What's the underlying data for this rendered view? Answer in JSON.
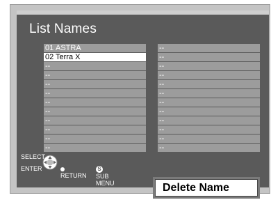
{
  "header": {
    "title": "List Names"
  },
  "list_left": [
    {
      "num": "01",
      "name": "ASTRA",
      "selected": false
    },
    {
      "num": "02",
      "name": "Terra X",
      "selected": true
    },
    {
      "num": "--",
      "name": ""
    },
    {
      "num": "--",
      "name": ""
    },
    {
      "num": "--",
      "name": ""
    },
    {
      "num": "--",
      "name": ""
    },
    {
      "num": "--",
      "name": ""
    },
    {
      "num": "--",
      "name": ""
    },
    {
      "num": "--",
      "name": ""
    },
    {
      "num": "--",
      "name": ""
    },
    {
      "num": "--",
      "name": ""
    },
    {
      "num": "--",
      "name": ""
    }
  ],
  "list_right": [
    {
      "num": "--",
      "name": ""
    },
    {
      "num": "--",
      "name": ""
    },
    {
      "num": "--",
      "name": ""
    },
    {
      "num": "--",
      "name": ""
    },
    {
      "num": "--",
      "name": ""
    },
    {
      "num": "--",
      "name": ""
    },
    {
      "num": "--",
      "name": ""
    },
    {
      "num": "--",
      "name": ""
    },
    {
      "num": "--",
      "name": ""
    },
    {
      "num": "--",
      "name": ""
    },
    {
      "num": "--",
      "name": ""
    },
    {
      "num": "--",
      "name": ""
    }
  ],
  "controls": {
    "select_label": "SELECT",
    "enter_label": "ENTER",
    "return_label": "RETURN",
    "sub_icon": "S",
    "sub_menu_label": "SUB MENU"
  },
  "popup": {
    "label": "Delete Name"
  }
}
